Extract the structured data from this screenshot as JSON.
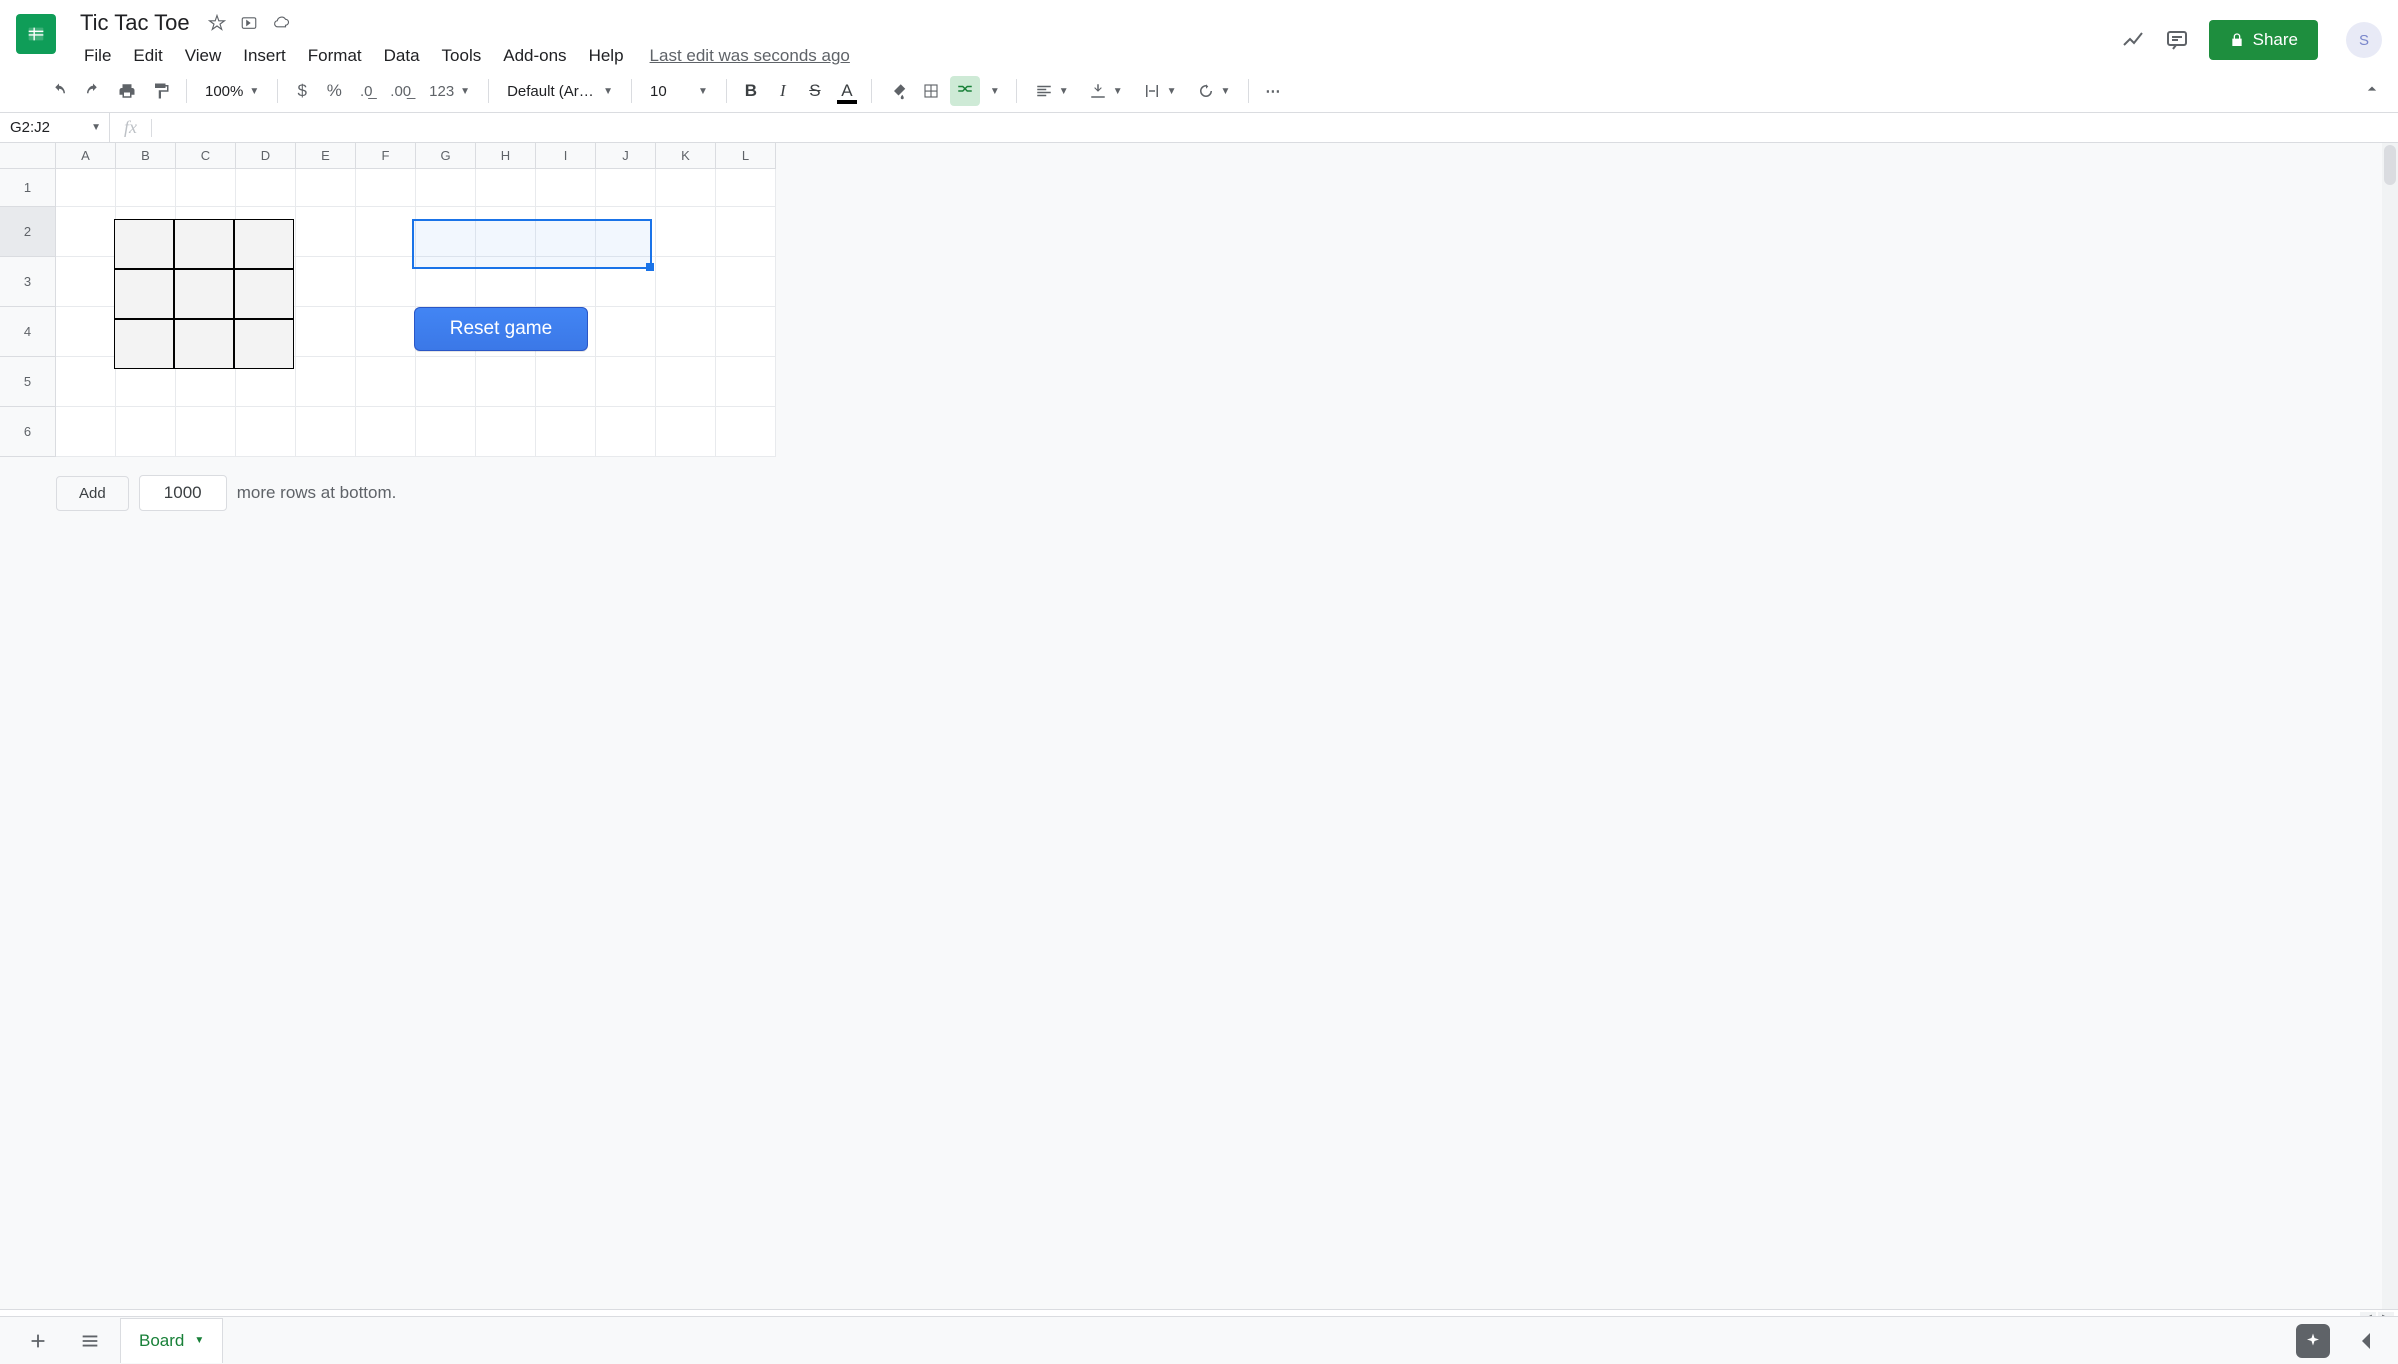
{
  "doc": {
    "title": "Tic Tac Toe",
    "last_edit": "Last edit was seconds ago"
  },
  "menu": {
    "file": "File",
    "edit": "Edit",
    "view": "View",
    "insert": "Insert",
    "format": "Format",
    "data": "Data",
    "tools": "Tools",
    "addons": "Add-ons",
    "help": "Help"
  },
  "share": {
    "label": "Share"
  },
  "avatar": {
    "letter": "S"
  },
  "toolbar": {
    "zoom": "100%",
    "font": "Default (Ari…",
    "size": "10",
    "more_format": "123"
  },
  "namebox": {
    "value": "G2:J2"
  },
  "fx": {
    "label": "fx"
  },
  "cols": {
    "A": "A",
    "B": "B",
    "C": "C",
    "D": "D",
    "E": "E",
    "F": "F",
    "G": "G",
    "H": "H",
    "I": "I",
    "J": "J",
    "K": "K",
    "L": "L"
  },
  "rows": {
    "r1": "1",
    "r2": "2",
    "r3": "3",
    "r4": "4",
    "r5": "5",
    "r6": "6"
  },
  "reset": {
    "label": "Reset game"
  },
  "addrows": {
    "btn": "Add",
    "count": "1000",
    "suffix": "more rows at bottom."
  },
  "tab": {
    "name": "Board"
  }
}
